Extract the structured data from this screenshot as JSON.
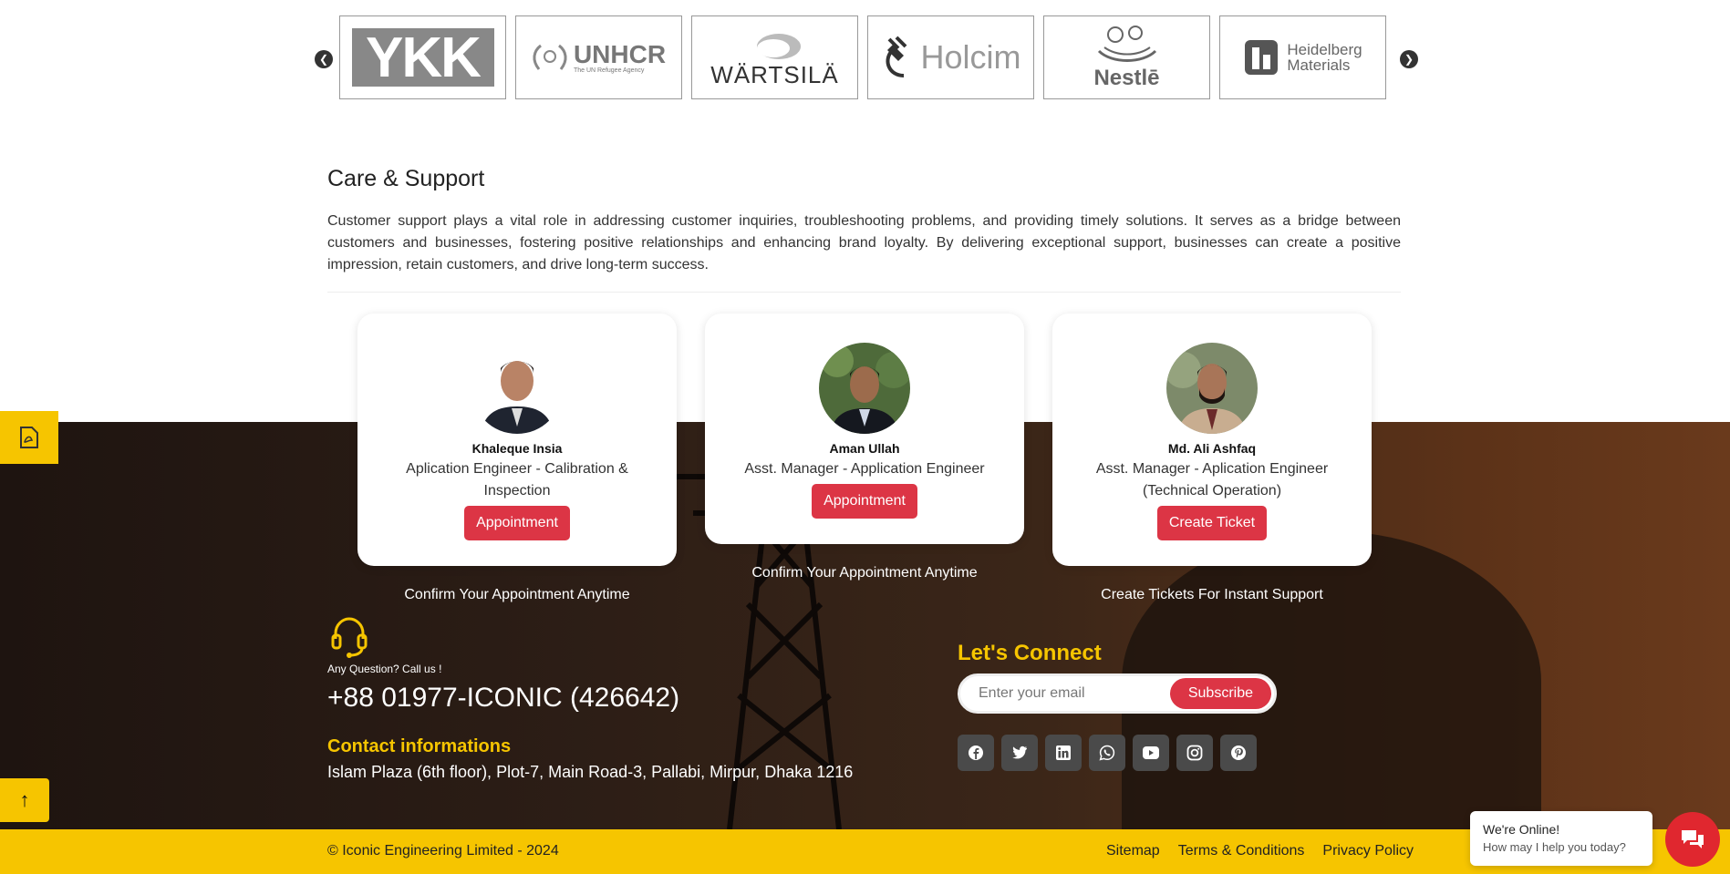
{
  "carousel": {
    "prev_icon": "chevron-left-icon",
    "next_icon": "chevron-right-icon",
    "logos": [
      {
        "name": "YKK",
        "text": "YKK"
      },
      {
        "name": "UNHCR",
        "text": "UNHCR",
        "sub": "The UN Refugee Agency"
      },
      {
        "name": "Wartsila",
        "text": "WÄRTSILÄ"
      },
      {
        "name": "Holcim",
        "text": "Holcim"
      },
      {
        "name": "Nestle",
        "text": "Nestlē"
      },
      {
        "name": "Heidelberg Materials",
        "line1": "Heidelberg",
        "line2": "Materials"
      }
    ]
  },
  "care": {
    "title": "Care & Support",
    "text": "Customer support plays a vital role in addressing customer inquiries, troubleshooting problems, and providing timely solutions. It serves as a bridge between customers and businesses, fostering positive relationships and enhancing brand loyalty. By delivering exceptional support, businesses can create a positive impression, retain customers, and drive long-term success."
  },
  "cards": [
    {
      "name": "Khaleque Insia",
      "role": "Aplication Engineer - Calibration & Inspection",
      "button": "Appointment",
      "caption": "Confirm Your Appointment Anytime"
    },
    {
      "name": "Aman Ullah",
      "role": "Asst. Manager - Application Engineer",
      "button": "Appointment",
      "caption": "Confirm Your Appointment Anytime"
    },
    {
      "name": "Md. Ali Ashfaq",
      "role": "Asst. Manager - Aplication Engineer (Technical Operation)",
      "button": "Create Ticket",
      "caption": "Create Tickets For Instant Support"
    }
  ],
  "contact": {
    "question": "Any Question? Call us !",
    "phone": "+88 01977-ICONIC (426642)",
    "heading": "Contact informations",
    "address": "Islam Plaza (6th floor), Plot-7, Main Road-3, Pallabi, Mirpur, Dhaka 1216"
  },
  "connect": {
    "heading": "Let's Connect",
    "email_placeholder": "Enter your email",
    "subscribe_label": "Subscribe",
    "socials": [
      "facebook-icon",
      "twitter-icon",
      "linkedin-icon",
      "whatsapp-icon",
      "youtube-icon",
      "instagram-icon",
      "pinterest-icon"
    ]
  },
  "footer": {
    "copyright": "© Iconic Engineering Limited - 2024",
    "links": [
      "Sitemap",
      "Terms & Conditions",
      "Privacy Policy"
    ]
  },
  "chat": {
    "title": "We're Online!",
    "subtitle": "How may I help you today?"
  },
  "colors": {
    "accent_yellow": "#f6c500",
    "button_red": "#dc3545"
  }
}
